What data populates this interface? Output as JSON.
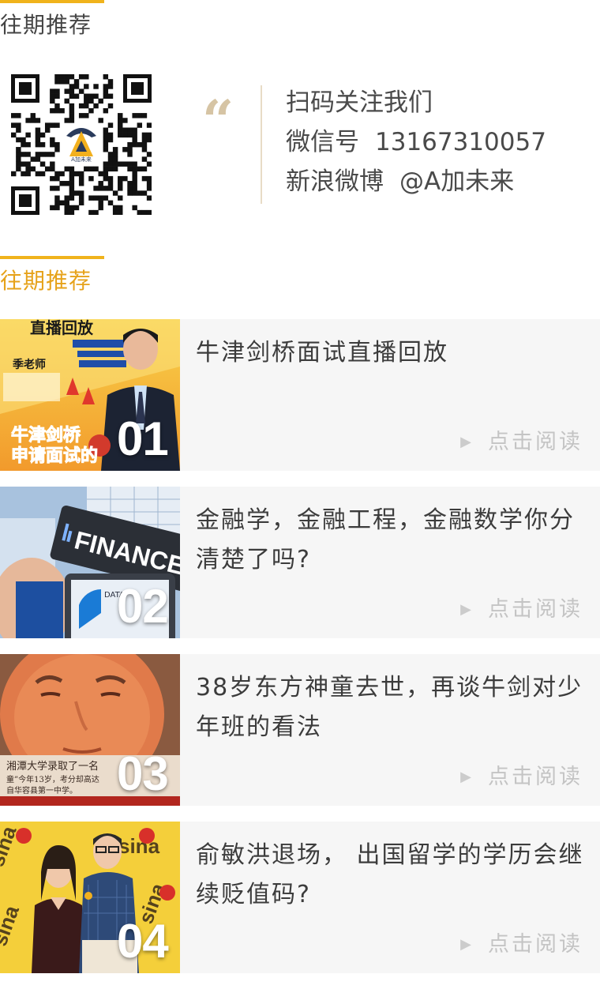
{
  "sections": {
    "past_recommend_1": "往期推荐",
    "past_recommend_2": "往期推荐"
  },
  "qr": {
    "logo_text": "A加未来"
  },
  "contact": {
    "quote_mark": "“",
    "follow_us": "扫码关注我们",
    "wechat_label": "微信号",
    "wechat_id": "13167310057",
    "weibo_label": "新浪微博",
    "weibo_handle": "@A加未来"
  },
  "articles": [
    {
      "num": "01",
      "title": "牛津剑桥面试直播回放",
      "read": "点击阅读",
      "thumb": {
        "heading": "直播回放",
        "teacher": "季老师",
        "subtitle": "牛津剑桥",
        "subtitle2": "申请面试的"
      }
    },
    {
      "num": "02",
      "title": "金融学，金融工程，金融数学你分清楚了吗?",
      "read": "点击阅读",
      "thumb": {
        "word": "FINANCE",
        "small": "DATA"
      }
    },
    {
      "num": "03",
      "title": "38岁东方神童去世，再谈牛剑对少年班的看法",
      "read": "点击阅读",
      "thumb": {
        "caption": "湘潭大学录取了一名",
        "caption2": "童”今年13岁，考分却高达",
        "caption3": "自华容县第一中学。"
      }
    },
    {
      "num": "04",
      "title": "俞敏洪退场， 出国留学的学历会继续贬值码?",
      "read": "点击阅读",
      "thumb": {
        "logo": "sina"
      }
    }
  ],
  "colors": {
    "accent": "#f0b31c",
    "accent_text": "#e6a21a",
    "card_bg": "#f6f6f6",
    "read": "#c4c4c4"
  },
  "icons": {
    "play": "play-triangle-icon"
  }
}
